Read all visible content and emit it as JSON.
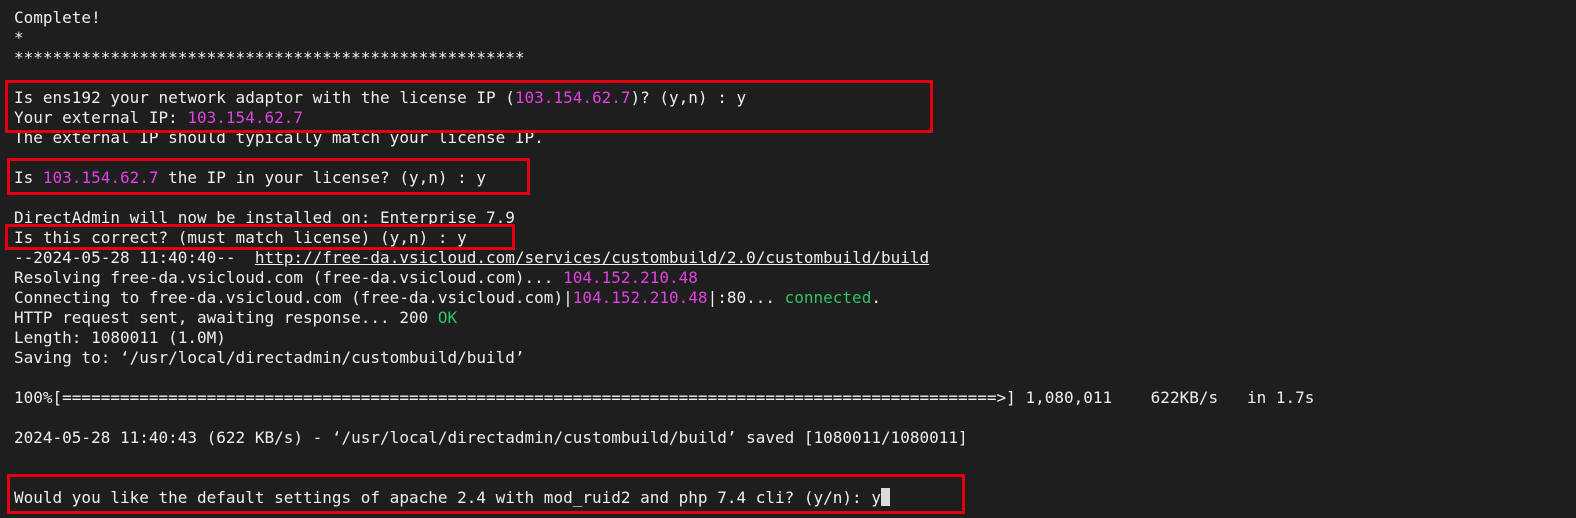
{
  "terminal": {
    "lines": [
      {
        "segments": [
          {
            "t": "Complete!"
          }
        ]
      },
      {
        "segments": [
          {
            "t": "*"
          }
        ]
      },
      {
        "segments": [
          {
            "t": "*****************************************************"
          }
        ]
      },
      {
        "segments": [
          {
            "t": ""
          }
        ]
      },
      {
        "segments": [
          {
            "t": "Is ens192 your network adaptor with the license IP ("
          },
          {
            "t": "103.154.62.7",
            "c": "magenta"
          },
          {
            "t": ")? (y,n) : y"
          }
        ]
      },
      {
        "segments": [
          {
            "t": "Your external IP: "
          },
          {
            "t": "103.154.62.7",
            "c": "magenta"
          }
        ]
      },
      {
        "segments": [
          {
            "t": "The external IP should typically match your license IP."
          }
        ]
      },
      {
        "segments": [
          {
            "t": ""
          }
        ]
      },
      {
        "segments": [
          {
            "t": "Is "
          },
          {
            "t": "103.154.62.7",
            "c": "magenta"
          },
          {
            "t": " the IP in your license? (y,n) : y"
          }
        ]
      },
      {
        "segments": [
          {
            "t": ""
          }
        ]
      },
      {
        "segments": [
          {
            "t": "DirectAdmin will now be installed on: Enterprise 7.9"
          }
        ]
      },
      {
        "segments": [
          {
            "t": "Is this correct? (must match license) (y,n) : y"
          }
        ]
      },
      {
        "segments": [
          {
            "t": "--2024-05-28 11:40:40--  "
          },
          {
            "t": "http://free-da.vsicloud.com/services/custombuild/2.0/custombuild/build",
            "c": "link"
          }
        ]
      },
      {
        "segments": [
          {
            "t": "Resolving free-da.vsicloud.com (free-da.vsicloud.com)... "
          },
          {
            "t": "104.152.210.48",
            "c": "magenta"
          }
        ]
      },
      {
        "segments": [
          {
            "t": "Connecting to free-da.vsicloud.com (free-da.vsicloud.com)|"
          },
          {
            "t": "104.152.210.48",
            "c": "magenta"
          },
          {
            "t": "|:80... "
          },
          {
            "t": "connected",
            "c": "green"
          },
          {
            "t": "."
          }
        ]
      },
      {
        "segments": [
          {
            "t": "HTTP request sent, awaiting response... 200 "
          },
          {
            "t": "OK",
            "c": "green"
          }
        ]
      },
      {
        "segments": [
          {
            "t": "Length: 1080011 (1.0M)"
          }
        ]
      },
      {
        "segments": [
          {
            "t": "Saving to: ‘/usr/local/directadmin/custombuild/build’"
          }
        ]
      },
      {
        "segments": [
          {
            "t": ""
          }
        ]
      },
      {
        "segments": [
          {
            "t": "100%[=================================================================================================>] 1,080,011    622KB/s   in 1.7s"
          }
        ]
      },
      {
        "segments": [
          {
            "t": ""
          }
        ]
      },
      {
        "segments": [
          {
            "t": "2024-05-28 11:40:43 (622 KB/s) - ‘/usr/local/directadmin/custombuild/build’ saved [1080011/1080011]"
          }
        ]
      },
      {
        "segments": [
          {
            "t": ""
          }
        ]
      },
      {
        "segments": [
          {
            "t": ""
          }
        ]
      },
      {
        "segments": [
          {
            "t": "Would you like the default settings of apache 2.4 with mod_ruid2 and php 7.4 cli? (y/n): y"
          }
        ],
        "cursor": true
      }
    ],
    "colors": {
      "background": "#1e1e1e",
      "text": "#eeeeee",
      "magenta": "#e142e1",
      "green": "#2ec45f",
      "highlight_border": "#e3000f"
    }
  }
}
